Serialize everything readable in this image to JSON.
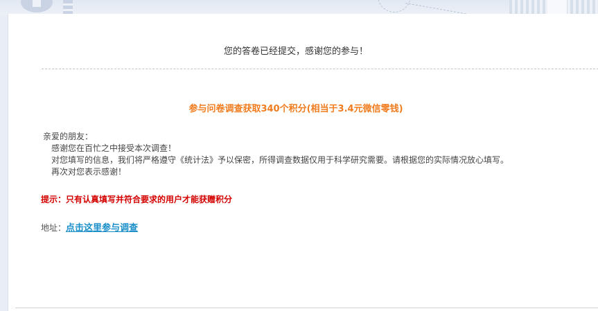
{
  "header": {
    "submitted_message": "您的答卷已经提交，感谢您的参与！"
  },
  "reward": {
    "title": "参与问卷调查获取340个积分(相当于3.4元微信零钱)"
  },
  "letter": {
    "greeting": "亲爱的朋友：",
    "lines": [
      "感谢您在百忙之中接受本次调查！",
      "对您填写的信息，我们将严格遵守《统计法》予以保密，所得调查数据仅用于科学研究需要。请根据您的实际情况放心填写。",
      "再次对您表示感谢！"
    ]
  },
  "tip": {
    "text": "提示：只有认真填写并符合要求的用户才能获赠积分"
  },
  "address": {
    "label": "地址：",
    "link_text": "点击这里参与调查"
  },
  "colors": {
    "reward_orange": "#f07c1e",
    "tip_red": "#d40000",
    "link_blue": "#1a8fc9"
  }
}
